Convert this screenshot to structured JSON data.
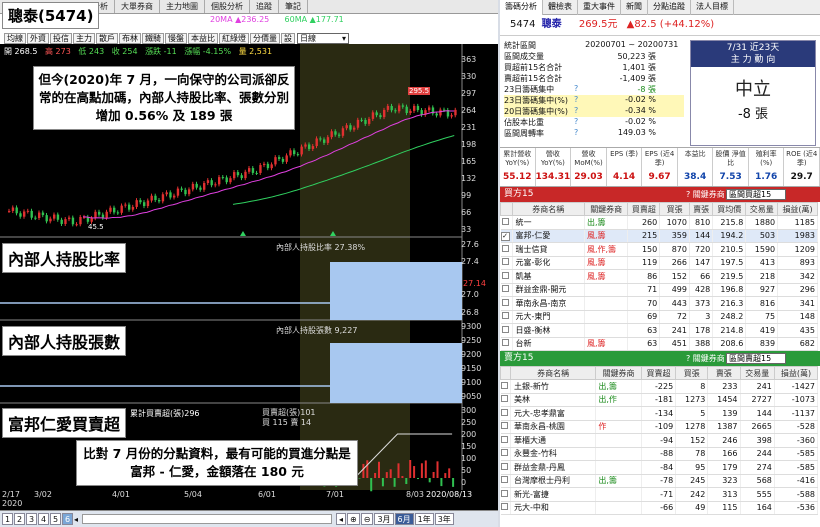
{
  "left": {
    "stock_title": "聰泰(5474)",
    "tabs": [
      "技術分析",
      "大單券商",
      "主力地圖",
      "個股分析",
      "追蹤",
      "筆記"
    ],
    "ma_legend": {
      "ma20": "20MA ▲236.25",
      "ma60": "60MA ▲177.71"
    },
    "buttons": [
      "均線",
      "外資",
      "投信",
      "主力",
      "散戶",
      "布林",
      "鐵騎",
      "慢盤",
      "本益比",
      "紅綠燈",
      "分價量",
      "設"
    ],
    "period": "日線",
    "ohlc": {
      "open": "開 268.5",
      "high": "高 273",
      "low": "低 243",
      "close": "收 254",
      "change": "漲跌 -11",
      "pct": "漲幅 -4.15%",
      "vol": "量 2,531"
    },
    "colors": {
      "up": "#d22222",
      "down": "#22a040",
      "ma20": "#e040e0",
      "ma60": "#30d060"
    },
    "price_axis": [
      "363",
      "330",
      "297",
      "264",
      "231",
      "198",
      "165",
      "132",
      "99",
      "66",
      "33"
    ],
    "price_labels": {
      "peak": "295.5",
      "low": "45.5"
    },
    "panel1_title": "內部人持股比率",
    "panel1_legend": "內部人持股比率 27.38%",
    "panel1_axis": [
      "27.6",
      "27.4",
      "27.2",
      "27.0",
      "26.8"
    ],
    "panel1_current": "27.14",
    "panel2_title": "內部人持股張數",
    "panel2_legend": "內部人持股張數 9,227",
    "panel2_axis": [
      "9300",
      "9250",
      "9200",
      "9150",
      "9100",
      "9050"
    ],
    "panel3_title": "富邦仁愛買賣超",
    "panel3_legend": "累計買賣超(張)296",
    "panel3_legend2a": "買賣超(張)101",
    "panel3_legend2b": "買 115 賣 14",
    "panel3_axis": [
      "300",
      "250",
      "200",
      "150",
      "100",
      "50",
      "0",
      "-50"
    ],
    "note_top": "但今(2020)年 7 月，一向保守的公司派卻反常的在高點加碼，內部人持股比率、張數分別增加 0.56% 及 189 張",
    "note_bottom": "比對 7 月份的分點資料，最有可能的買進分點是富邦 - 仁愛，金額落在 180 元",
    "x_labels": [
      "2/17",
      "3/02",
      "4/01",
      "5/04",
      "6/01",
      "7/01",
      "8/03",
      "2020/08/13"
    ],
    "x_year": "2020",
    "pages": [
      "1",
      "2",
      "3",
      "4",
      "5",
      "6"
    ],
    "zoom": [
      "3月",
      "6月",
      "1年",
      "3年"
    ],
    "zoom_active": "6月",
    "zoom_last": "▾"
  },
  "right": {
    "tabs": [
      "籌碼分析",
      "體檢表",
      "重大事件",
      "新聞",
      "分點追蹤",
      "法人目標"
    ],
    "quote": {
      "code": "5474",
      "name": "聰泰",
      "price": "269.5元",
      "change": "▲82.5 (+44.12%)"
    },
    "stats": [
      {
        "k": "統計區間",
        "q": "",
        "v": "20200701 ~ 20200731"
      },
      {
        "k": "區間成交量",
        "q": "",
        "v": "50,223 張"
      },
      {
        "k": "買超前15名合計",
        "q": "",
        "v": "1,401 張"
      },
      {
        "k": "賣超前15名合計",
        "q": "",
        "v": "-1,409 張"
      },
      {
        "k": "23日籌碼集中",
        "q": "?",
        "v": "-8 張"
      },
      {
        "k": "23日籌碼集中(%)",
        "q": "?",
        "v": "-0.02 %"
      },
      {
        "k": "20日籌碼集中(%)",
        "q": "?",
        "v": "-0.34 %"
      },
      {
        "k": "佔股本比重",
        "q": "?",
        "v": "-0.02 %"
      },
      {
        "k": "區間周轉率",
        "q": "?",
        "v": "149.03 %"
      }
    ],
    "focus": {
      "head1": "7/31 近23天",
      "head2": "主 力 動 向",
      "big": "中立",
      "num": "-8 張"
    },
    "ratios": [
      {
        "h": "累計營收 YoY(%)",
        "v": "55.12"
      },
      {
        "h": "營收 YoY(%)",
        "v": "134.31"
      },
      {
        "h": "營收 MoM(%)",
        "v": "29.03"
      },
      {
        "h": "EPS (季)",
        "v": "4.14"
      },
      {
        "h": "EPS (近4季)",
        "v": "9.67"
      },
      {
        "h": "本益比",
        "v": "38.4"
      },
      {
        "h": "股價 淨值比",
        "v": "7.53"
      },
      {
        "h": "殖利率 (%)",
        "v": "1.76"
      },
      {
        "h": "ROE (近4季)",
        "v": "29.7"
      }
    ],
    "buy": {
      "title": "買方15",
      "range_label": "? 關鍵券商",
      "select": "區間買超15",
      "headers": [
        "",
        "券商名稱",
        "關鍵券商",
        "買賣超",
        "買張",
        "賣張",
        "買均價",
        "交易量",
        "損益(萬)"
      ],
      "rows": [
        [
          "統一",
          "出,籌",
          "260",
          "1070",
          "810",
          "215.8",
          "1880",
          "1185"
        ],
        [
          "富邦-仁愛",
          "風,籌",
          "215",
          "359",
          "144",
          "194.2",
          "503",
          "1983"
        ],
        [
          "瑞士信貸",
          "風,作,籌",
          "150",
          "870",
          "720",
          "210.5",
          "1590",
          "1209"
        ],
        [
          "元富-彰化",
          "風,籌",
          "119",
          "266",
          "147",
          "197.5",
          "413",
          "893"
        ],
        [
          "凱基",
          "風,籌",
          "86",
          "152",
          "66",
          "219.5",
          "218",
          "342"
        ],
        [
          "群益金鼎-開元",
          "",
          "71",
          "499",
          "428",
          "196.8",
          "927",
          "296"
        ],
        [
          "華南永昌-南京",
          "",
          "70",
          "443",
          "373",
          "216.3",
          "816",
          "341"
        ],
        [
          "元大-東門",
          "",
          "69",
          "72",
          "3",
          "248.2",
          "75",
          "148"
        ],
        [
          "日盛-衡林",
          "",
          "63",
          "241",
          "178",
          "214.8",
          "419",
          "435"
        ],
        [
          "台新",
          "風,籌",
          "63",
          "451",
          "388",
          "208.6",
          "839",
          "682"
        ]
      ]
    },
    "sell": {
      "title": "賣方15",
      "range_label": "? 關鍵券商",
      "select": "區間賣超15",
      "headers": [
        "",
        "券商名稱",
        "關鍵券商",
        "買賣超",
        "買張",
        "賣張",
        "交易量",
        "損益(萬)"
      ],
      "rows": [
        [
          "土銀-新竹",
          "出,籌",
          "-225",
          "8",
          "233",
          "241",
          "-1427"
        ],
        [
          "美林",
          "出,作",
          "-181",
          "1273",
          "1454",
          "2727",
          "-1073"
        ],
        [
          "元大-忠孝鼎富",
          "",
          "-134",
          "5",
          "139",
          "144",
          "-1137"
        ],
        [
          "華南永昌-桃園",
          "作",
          "-109",
          "1278",
          "1387",
          "2665",
          "-528"
        ],
        [
          "華櫃大通",
          "",
          "-94",
          "152",
          "246",
          "398",
          "-360"
        ],
        [
          "永豐金-竹科",
          "",
          "-88",
          "78",
          "166",
          "244",
          "-585"
        ],
        [
          "群益金鼎-丹鳳",
          "",
          "-84",
          "95",
          "179",
          "274",
          "-585"
        ],
        [
          "台灣摩根士丹利",
          "出,籌",
          "-78",
          "245",
          "323",
          "568",
          "-416"
        ],
        [
          "新光-富捷",
          "",
          "-71",
          "242",
          "313",
          "555",
          "-588"
        ],
        [
          "元大-中和",
          "",
          "-66",
          "49",
          "115",
          "164",
          "-536"
        ]
      ]
    }
  }
}
